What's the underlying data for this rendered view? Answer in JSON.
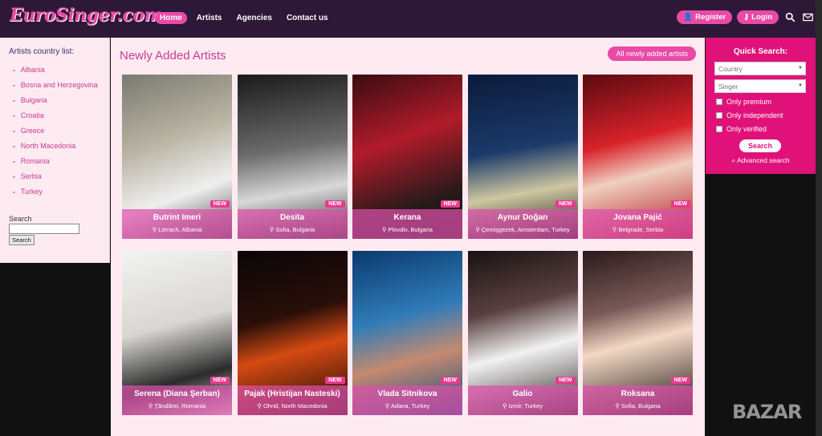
{
  "brand": {
    "logo_text": "EuroSinger.com",
    "accent": "#e94aa6"
  },
  "nav": [
    {
      "label": "Home",
      "active": true
    },
    {
      "label": "Artists",
      "active": false
    },
    {
      "label": "Agencies",
      "active": false
    },
    {
      "label": "Contact us",
      "active": false
    }
  ],
  "header_actions": {
    "register": "Register",
    "login": "Login",
    "icons": [
      "search-icon",
      "mail-icon"
    ]
  },
  "left_sidebar": {
    "title": "Artists country list:",
    "countries": [
      "Albania",
      "Bosna and Herzegovina",
      "Bulgaria",
      "Croatia",
      "Greece",
      "North Macedonia",
      "Romania",
      "Serbia",
      "Turkey"
    ],
    "search_label": "Search",
    "search_value": "",
    "search_button": "Search"
  },
  "main": {
    "title": "Newly Added Artists",
    "all_button": "All newly added artists",
    "badge": "NEW",
    "artists": [
      {
        "name": "Butrint Imeri",
        "location": "Lörrach, Albania"
      },
      {
        "name": "Desita",
        "location": "Sofia, Bulgaria"
      },
      {
        "name": "Kerana",
        "location": "Plovdiv, Bulgaria"
      },
      {
        "name": "Aynur Doğan",
        "location": "Çemişgezek, Amsterdam, Turkey"
      },
      {
        "name": "Jovana Pajić",
        "location": "Belgrade, Serbia"
      },
      {
        "name": "Serena (Diana Şerban)",
        "location": "Ţăndărei, Romania"
      },
      {
        "name": "Pajak (Hristijan Nasteski)",
        "location": "Ohrid, North Macedonia"
      },
      {
        "name": "Vlada Sitnikova",
        "location": "Adana, Turkey"
      },
      {
        "name": "Galio",
        "location": "Izmir, Turkey"
      },
      {
        "name": "Roksana",
        "location": "Sofia, Bulgaria"
      }
    ]
  },
  "quick_search": {
    "title": "Quick Search:",
    "country_placeholder": "Country",
    "type_placeholder": "Singer",
    "checks": [
      "Only premium",
      "Only independent",
      "Only verified"
    ],
    "search_button": "Search",
    "advanced": "Advanced search"
  },
  "watermark": "BAZAR"
}
